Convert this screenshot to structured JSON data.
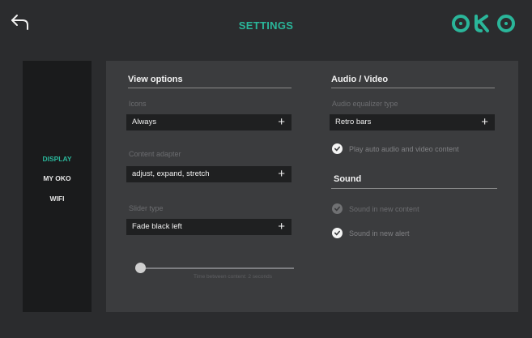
{
  "header": {
    "title": "SETTINGS",
    "logo_text": "OKO",
    "accent_color": "#2ab69a",
    "back_icon": "back-arrow-icon"
  },
  "sidebar": {
    "items": [
      {
        "label": "DISPLAY",
        "active": true
      },
      {
        "label": "MY OKO",
        "active": false
      },
      {
        "label": "WIFI",
        "active": false
      }
    ]
  },
  "view_options": {
    "title": "View options",
    "icons": {
      "label": "Icons",
      "value": "Always"
    },
    "content_adapter": {
      "label": "Content adapter",
      "value": "adjust, expand, stretch"
    },
    "slider_type": {
      "label": "Slider type",
      "value": "Fade black left"
    },
    "slider": {
      "caption": "Time between content: 2 seconds",
      "level": 0
    }
  },
  "audio_video": {
    "title": "Audio / Video",
    "equalizer": {
      "label": "Audio equalizer type",
      "value": "Retro bars"
    },
    "autoplay": {
      "label": "Play auto audio and video content",
      "checked": true
    }
  },
  "sound": {
    "title": "Sound",
    "new_content": {
      "label": "Sound in new content",
      "checked": true,
      "disabled": true
    },
    "new_alert": {
      "label": "Sound in new alert",
      "checked": true
    }
  }
}
